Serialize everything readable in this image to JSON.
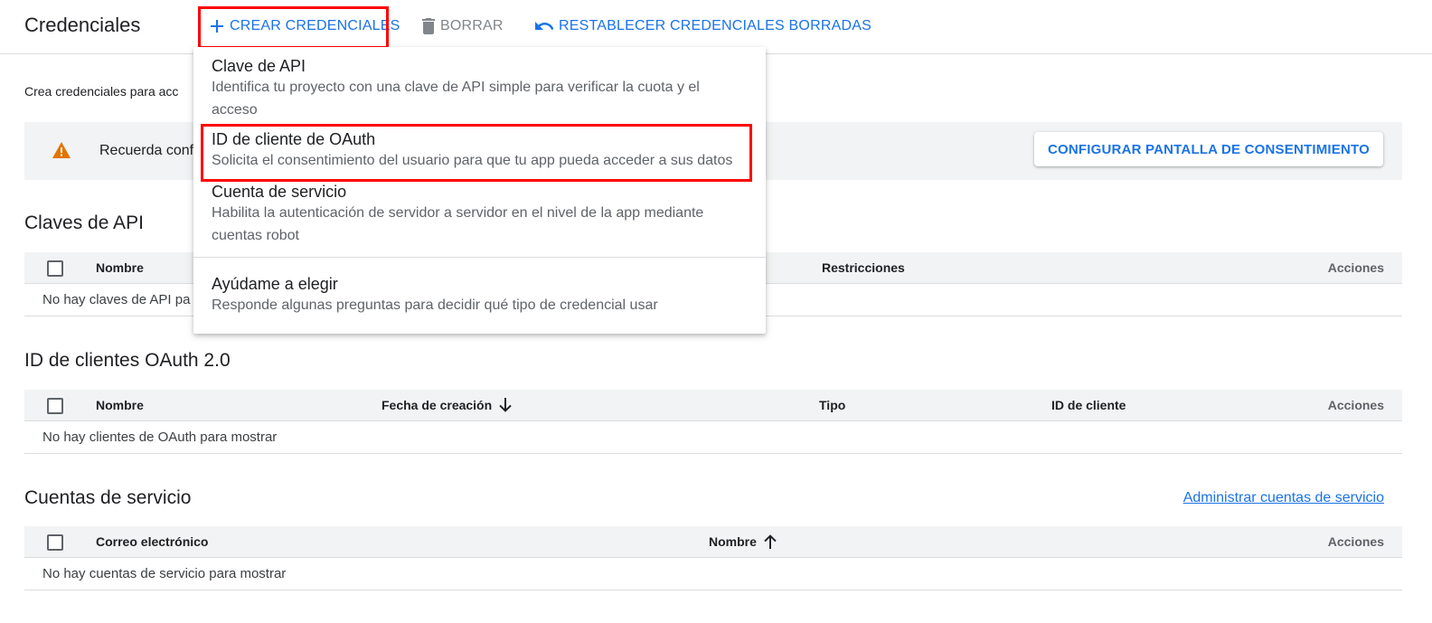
{
  "header": {
    "title": "Credenciales",
    "create_label": "CREAR CREDENCIALES",
    "delete_label": "BORRAR",
    "restore_label": "RESTABLECER CREDENCIALES BORRADAS"
  },
  "intro_text": "Crea credenciales para acc",
  "banner": {
    "text": "Recuerda confi",
    "button_label": "CONFIGURAR PANTALLA DE CONSENTIMIENTO"
  },
  "api_keys": {
    "title": "Claves de API",
    "columns": {
      "name": "Nombre",
      "restrictions": "Restricciones",
      "actions": "Acciones"
    },
    "empty": "No hay claves de API pa"
  },
  "oauth": {
    "title": "ID de clientes OAuth 2.0",
    "columns": {
      "name": "Nombre",
      "created": "Fecha de creación",
      "type": "Tipo",
      "client_id": "ID de cliente",
      "actions": "Acciones"
    },
    "empty": "No hay clientes de OAuth para mostrar"
  },
  "service_accounts": {
    "title": "Cuentas de servicio",
    "manage_link": "Administrar cuentas de servicio",
    "columns": {
      "email": "Correo electrónico",
      "name": "Nombre",
      "actions": "Acciones"
    },
    "empty": "No hay cuentas de servicio para mostrar"
  },
  "menu": {
    "items": [
      {
        "title": "Clave de API",
        "desc": "Identifica tu proyecto con una clave de API simple para verificar la cuota y el acceso"
      },
      {
        "title": "ID de cliente de OAuth",
        "desc": "Solicita el consentimiento del usuario para que tu app pueda acceder a sus datos"
      },
      {
        "title": "Cuenta de servicio",
        "desc": "Habilita la autenticación de servidor a servidor en el nivel de la app mediante cuentas robot"
      },
      {
        "title": "Ayúdame a elegir",
        "desc": "Responde algunas preguntas para decidir qué tipo de credencial usar"
      }
    ]
  },
  "colors": {
    "accent": "#1a73e8",
    "highlight": "#ff0000",
    "warning": "#e37400"
  },
  "icons": {
    "create": "plus-icon",
    "delete": "trash-icon",
    "restore": "undo-icon",
    "warning": "warning-icon",
    "sort_down": "arrow-down-icon",
    "sort_up": "arrow-up-icon"
  }
}
